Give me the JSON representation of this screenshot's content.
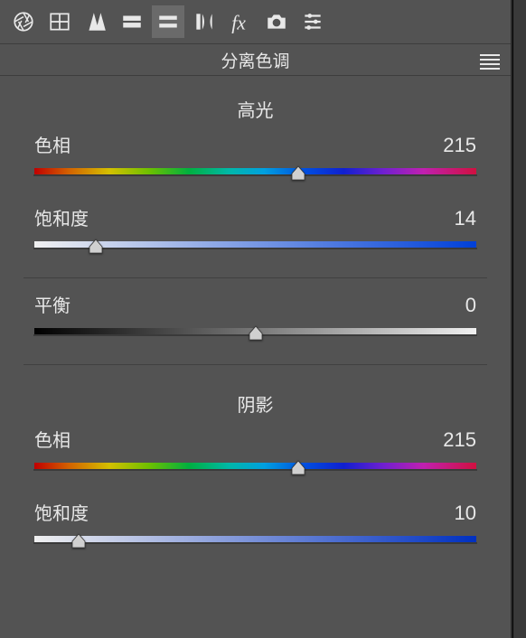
{
  "panel": {
    "title": "分离色调"
  },
  "sections": {
    "highlights": {
      "title": "高光",
      "hue": {
        "label": "色相",
        "value": "215",
        "pct": 59.7
      },
      "saturation": {
        "label": "饱和度",
        "value": "14",
        "pct": 14
      }
    },
    "balance": {
      "label": "平衡",
      "value": "0",
      "pct": 50
    },
    "shadows": {
      "title": "阴影",
      "hue": {
        "label": "色相",
        "value": "215",
        "pct": 59.7
      },
      "saturation": {
        "label": "饱和度",
        "value": "10",
        "pct": 10
      }
    }
  }
}
